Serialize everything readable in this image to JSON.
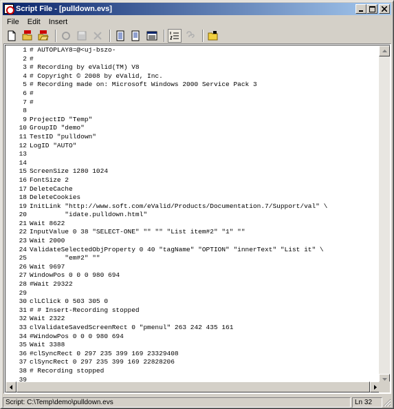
{
  "window": {
    "title": "Script File - [pulldown.evs]"
  },
  "menu": {
    "items": [
      "File",
      "Edit",
      "Insert"
    ]
  },
  "toolbar": {
    "buttons": [
      "new-icon",
      "open-bug-icon",
      "open-folder-icon",
      "disabled-icon",
      "save-icon",
      "cut-icon",
      "document-icon",
      "copy-icon",
      "window-icon",
      "numbered-list-icon",
      "help-icon",
      "folder-icon"
    ]
  },
  "editor": {
    "lines": [
      "# AUTOPLAY8=@<uj-bszo-",
      "#",
      "# Recording by eValid(TM) V8",
      "# Copyright © 2008 by eValid, Inc.",
      "# Recording made on: Microsoft Windows 2000 Service Pack 3",
      "#",
      "#",
      "",
      "ProjectID \"Temp\"",
      "GroupID \"demo\"",
      "TestID \"pulldown\"",
      "LogID \"AUTO\"",
      "",
      "",
      "ScreenSize 1280 1024",
      "FontSize 2",
      "DeleteCache",
      "DeleteCookies",
      "InitLink \"http://www.soft.com/eValid/Products/Documentation.7/Support/val\" \\",
      "         \"idate.pulldown.html\"",
      "Wait 8622",
      "InputValue 0 38 \"SELECT-ONE\" \"\" \"\" \"List item#2\" \"1\" \"\"",
      "Wait 2000",
      "ValidateSelectedObjProperty 0 40 \"tagName\" \"OPTION\" \"innerText\" \"List it\" \\",
      "         \"em#2\" \"\"",
      "Wait 9697",
      "WindowPos 0 0 0 980 694",
      "#Wait 29322",
      "",
      "clLClick 0 503 305 0",
      "# # Insert-Recording stopped",
      "Wait 2322",
      "clValidateSavedScreenRect 0 \"pmenul\" 263 242 435 161",
      "#WindowPos 0 0 0 980 694",
      "Wait 3388",
      "#clSyncRect 0 297 235 399 169 23329408",
      "clSyncRect 0 297 235 399 169 22828206",
      "# Recording stopped",
      ""
    ]
  },
  "status": {
    "path": "Script: C:\\Temp\\demo\\pulldown.evs",
    "line": "Ln 32"
  }
}
